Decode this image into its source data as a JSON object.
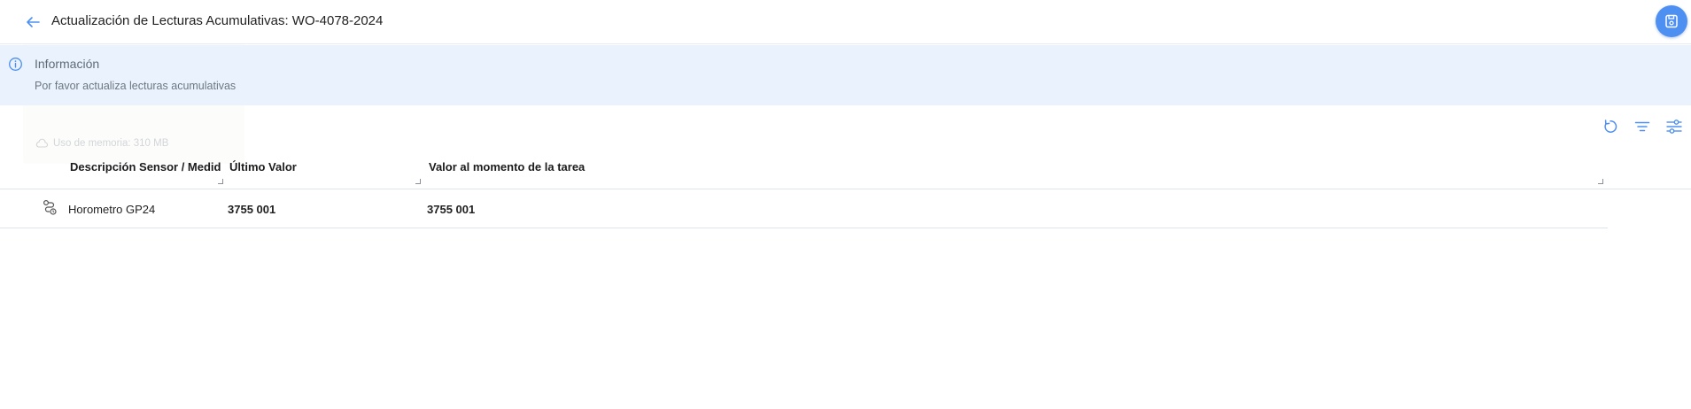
{
  "header": {
    "title": "Actualización de Lecturas Acumulativas: WO-4078-2024",
    "back_icon": "arrow-left-icon",
    "save_icon": "save-icon",
    "accent_color": "#4e8ff2"
  },
  "info": {
    "title": "Información",
    "message": "Por favor actualiza lecturas acumulativas",
    "background": "#eaf3fd"
  },
  "overlay": {
    "memory_label": "Uso de memoria: 310 MB"
  },
  "toolbar": {
    "icons": [
      "refresh-icon",
      "filter-icon",
      "column-settings-icon"
    ]
  },
  "table": {
    "columns": [
      "Descripción Sensor / Medid...",
      "Último Valor",
      "Valor al momento de la tarea"
    ],
    "rows": [
      {
        "icon": "sensor-icon",
        "description": "Horometro GP24",
        "last_value": "3755 001",
        "task_value": "3755 001"
      }
    ]
  }
}
